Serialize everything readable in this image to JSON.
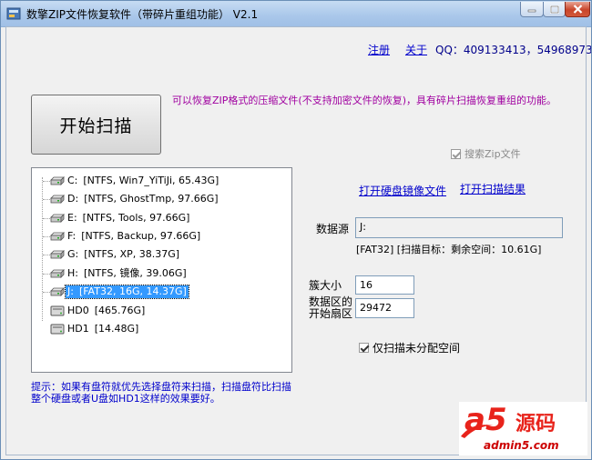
{
  "window": {
    "title": "数擎ZIP文件恢复软件（带碎片重组功能） V2.1"
  },
  "header": {
    "register_link": "注册",
    "about_link": "关于",
    "qq_text": "QQ：409133413，54968973"
  },
  "main": {
    "start_button": "开始扫描",
    "description": "可以恢复ZIP格式的压缩文件(不支持加密文件的恢复)，具有碎片扫描恢复重组的功能。",
    "search_zip_label": "搜索Zip文件",
    "search_zip_checked": true,
    "open_image_link": "打开硬盘镜像文件",
    "open_scan_result_link": "打开扫描结果",
    "hint": "提示：如果有盘符就优先选择盘符来扫描，扫描盘符比扫描整个硬盘或者U盘如HD1这样的效果要好。"
  },
  "drives": [
    {
      "letter": "C:",
      "info": "[NTFS, Win7_YiTiJi, 65.43G]",
      "type": "partition",
      "selected": false
    },
    {
      "letter": "D:",
      "info": "[NTFS, GhostTmp, 97.66G]",
      "type": "partition",
      "selected": false
    },
    {
      "letter": "E:",
      "info": "[NTFS, Tools, 97.66G]",
      "type": "partition",
      "selected": false
    },
    {
      "letter": "F:",
      "info": "[NTFS, Backup, 97.66G]",
      "type": "partition",
      "selected": false
    },
    {
      "letter": "G:",
      "info": "[NTFS, XP, 38.37G]",
      "type": "partition",
      "selected": false
    },
    {
      "letter": "H:",
      "info": "[NTFS, 镜像, 39.06G]",
      "type": "partition",
      "selected": false
    },
    {
      "letter": "J:",
      "info": "[FAT32, 16G, 14.37G]",
      "type": "partition",
      "selected": true
    },
    {
      "letter": "HD0",
      "info": "[465.76G]",
      "type": "disk",
      "selected": false
    },
    {
      "letter": "HD1",
      "info": "[14.48G]",
      "type": "disk",
      "selected": false
    }
  ],
  "details": {
    "source_label": "数据源",
    "source_value": "J:",
    "source_info": "[FAT32]  [扫描目标：剩余空间：10.61G]",
    "cluster_label": "簇大小",
    "cluster_value": "16",
    "start_sector_label_1": "数据区的",
    "start_sector_label_2": "开始扇区",
    "start_sector_value": "29472",
    "unallocated_label": "仅扫描未分配空间",
    "unallocated_checked": true
  },
  "watermark": {
    "logo_a5": "a5",
    "logo_text": "源码",
    "url": "admin5.com"
  },
  "colors": {
    "link": "#0000cc",
    "description": "#a000a0",
    "selection": "#3399ff",
    "watermark_red": "#e8231b"
  }
}
